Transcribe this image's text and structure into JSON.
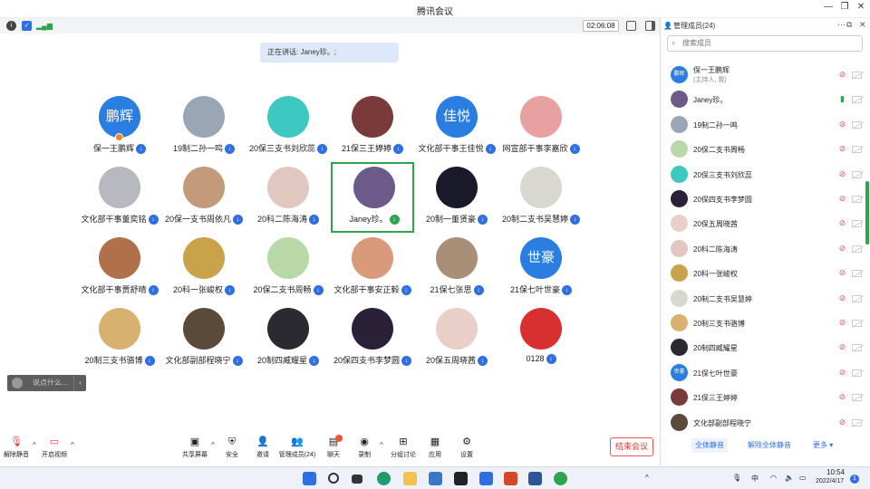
{
  "app": {
    "title": "腾讯会议"
  },
  "status": {
    "timer": "02:06:08"
  },
  "speaking": "正在讲话: Janey珍。;",
  "tiles": [
    {
      "name": "保一王鹏辉",
      "avatar_text": "鹏辉",
      "color": "#2a7de1",
      "host": true
    },
    {
      "name": "19制二孙一鸣",
      "avatar_text": "",
      "color": "#9aa6b5"
    },
    {
      "name": "20保三支书刘欣蕊",
      "avatar_text": "",
      "color": "#3dc9c2"
    },
    {
      "name": "21保三王婷婷",
      "avatar_text": "",
      "color": "#7a3a3a"
    },
    {
      "name": "文化部干事王佳悦",
      "avatar_text": "佳悦",
      "color": "#2a7de1"
    },
    {
      "name": "网宣部干事李嘉欣",
      "avatar_text": "",
      "color": "#e8a0a0"
    },
    {
      "name": "文化部干事董奕铭",
      "avatar_text": "",
      "color": "#b8b8c0"
    },
    {
      "name": "20保一支书周依凡",
      "avatar_text": "",
      "color": "#c39a7a"
    },
    {
      "name": "20科二陈海涛",
      "avatar_text": "",
      "color": "#e0c8c0"
    },
    {
      "name": "Janey珍。",
      "avatar_text": "",
      "color": "#6b5a8a",
      "selected": true
    },
    {
      "name": "20制一董贤豪",
      "avatar_text": "",
      "color": "#1a1a2a"
    },
    {
      "name": "20制二支书吴慧婷",
      "avatar_text": "",
      "color": "#d8d8d0"
    },
    {
      "name": "文化部干事贾舒晴",
      "avatar_text": "",
      "color": "#b0704a"
    },
    {
      "name": "20科一张峻权",
      "avatar_text": "",
      "color": "#c9a24a"
    },
    {
      "name": "20保二支书周畅",
      "avatar_text": "",
      "color": "#b8d8a8"
    },
    {
      "name": "文化部干事安正毅",
      "avatar_text": "",
      "color": "#d89a78"
    },
    {
      "name": "21保七张思",
      "avatar_text": "",
      "color": "#a89078"
    },
    {
      "name": "21保七叶世豪",
      "avatar_text": "世豪",
      "color": "#2a7de1"
    },
    {
      "name": "20制三支书骆博",
      "avatar_text": "",
      "color": "#d8b070"
    },
    {
      "name": "文化部副部程晓宁",
      "avatar_text": "",
      "color": "#5a4a3a"
    },
    {
      "name": "20制四臧耀星",
      "avatar_text": "",
      "color": "#2a2a30"
    },
    {
      "name": "20保四支书李梦圆",
      "avatar_text": "",
      "color": "#2a2038"
    },
    {
      "name": "20保五周晓茜",
      "avatar_text": "",
      "color": "#e8d0c8"
    },
    {
      "name": "0128",
      "avatar_text": "",
      "color": "#d83030"
    }
  ],
  "chat_mini": "说点什么...",
  "toolbar": {
    "mute": "解除静音",
    "video": "开启视频",
    "share": "共享屏幕",
    "security": "安全",
    "invite": "邀请",
    "members": "管理成员(24)",
    "chat": "聊天",
    "record": "录制",
    "breakout": "分组讨论",
    "apps": "应用",
    "settings": "设置",
    "end": "结束会议"
  },
  "panel": {
    "title": "管理成员(24)",
    "search_placeholder": "搜索成员",
    "members": [
      {
        "name": "保一王鹏辉",
        "sub": "(主持人, 我)",
        "avatar_text": "鹏辉",
        "color": "#2a7de1",
        "host": true
      },
      {
        "name": "Janey珍。",
        "color": "#6b5a8a",
        "speaking": true
      },
      {
        "name": "19制二孙一鸣",
        "color": "#9aa6b5"
      },
      {
        "name": "20保二支书周畅",
        "color": "#b8d8a8"
      },
      {
        "name": "20保三支书刘欣蕊",
        "color": "#3dc9c2"
      },
      {
        "name": "20保四支书李梦圆",
        "color": "#2a2038"
      },
      {
        "name": "20保五周晓茜",
        "color": "#e8d0c8"
      },
      {
        "name": "20科二陈海涛",
        "color": "#e0c8c0"
      },
      {
        "name": "20科一张峻权",
        "color": "#c9a24a"
      },
      {
        "name": "20制二支书吴慧婷",
        "color": "#d8d8d0"
      },
      {
        "name": "20制三支书骆博",
        "color": "#d8b070"
      },
      {
        "name": "20制四臧耀星",
        "color": "#2a2a30"
      },
      {
        "name": "21保七叶世豪",
        "avatar_text": "世豪",
        "color": "#2a7de1"
      },
      {
        "name": "21保三王婷婷",
        "color": "#7a3a3a"
      },
      {
        "name": "文化部副部程晓宁",
        "color": "#5a4a3a"
      }
    ],
    "mute_all": "全体静音",
    "unmute_all": "解除全体静音",
    "more": "更多 ▾"
  },
  "taskbar": {
    "time": "10:54",
    "date": "2022/4/17",
    "ime": "中",
    "notif": "1"
  }
}
